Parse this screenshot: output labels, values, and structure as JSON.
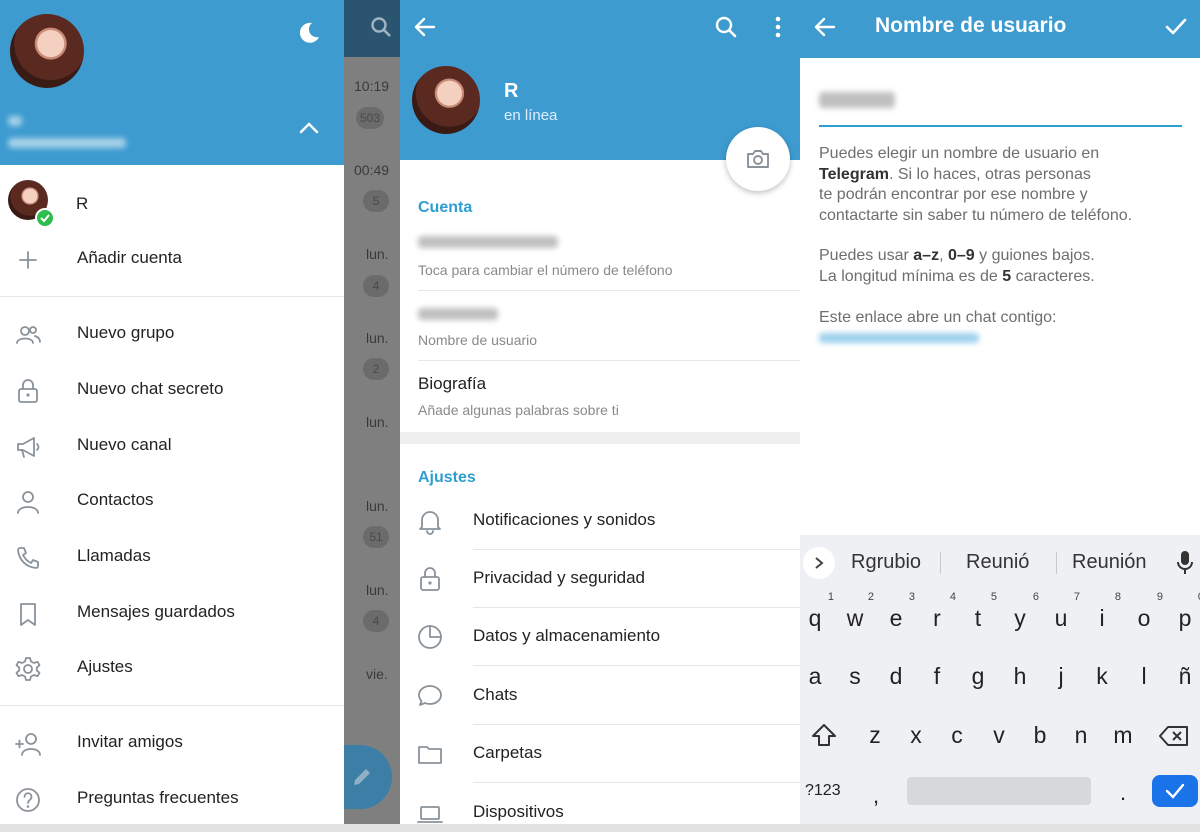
{
  "drawer": {
    "account_name": "R",
    "add_account_label": "Añadir cuenta",
    "items": [
      {
        "label": "Nuevo grupo",
        "icon": "people-icon"
      },
      {
        "label": "Nuevo chat secreto",
        "icon": "lock-icon"
      },
      {
        "label": "Nuevo canal",
        "icon": "megaphone-icon"
      },
      {
        "label": "Contactos",
        "icon": "person-icon"
      },
      {
        "label": "Llamadas",
        "icon": "phone-icon"
      },
      {
        "label": "Mensajes guardados",
        "icon": "bookmark-icon"
      },
      {
        "label": "Ajustes",
        "icon": "gear-icon"
      }
    ],
    "extra_items": [
      {
        "label": "Invitar amigos",
        "icon": "add-person-icon"
      },
      {
        "label": "Preguntas frecuentes",
        "icon": "question-icon"
      }
    ]
  },
  "chat_list": {
    "times": [
      "10:19",
      "00:49",
      "lun.",
      "lun.",
      "lun.",
      "lun.",
      "lun.",
      "vie."
    ],
    "badges": [
      "503",
      "5",
      "4",
      "2",
      "51",
      "4"
    ]
  },
  "profile": {
    "name": "R",
    "status": "en línea",
    "account_section": "Cuenta",
    "phone_hint": "Toca para cambiar el número de teléfono",
    "username_hint": "Nombre de usuario",
    "bio_label": "Biografía",
    "bio_hint": "Añade algunas palabras sobre ti",
    "settings_section": "Ajustes",
    "settings": [
      {
        "label": "Notificaciones y sonidos",
        "icon": "bell-icon"
      },
      {
        "label": "Privacidad y seguridad",
        "icon": "lock-icon"
      },
      {
        "label": "Datos y almacenamiento",
        "icon": "clock-icon"
      },
      {
        "label": "Chats",
        "icon": "chat-bubble-icon"
      },
      {
        "label": "Carpetas",
        "icon": "folder-icon"
      },
      {
        "label": "Dispositivos",
        "icon": "laptop-icon"
      }
    ]
  },
  "username": {
    "title": "Nombre de usuario",
    "p1_a": "Puedes elegir un nombre de usuario en",
    "p1_b": "Telegram",
    "p1_c": ". Si lo haces, otras personas",
    "p1_d": "te podrán encontrar por ese nombre y",
    "p1_e": "contactarte sin saber tu número de teléfono.",
    "p2_a": "Puedes usar ",
    "p2_b": "a–z",
    "p2_c": ", ",
    "p2_d": "0–9",
    "p2_e": " y guiones bajos.",
    "p3_a": "La longitud mínima es de ",
    "p3_b": "5",
    "p3_c": " caracteres.",
    "p4": "Este enlace abre un chat contigo:"
  },
  "keyboard": {
    "suggestions": [
      "Rgrubio",
      "Reunió",
      "Reunión"
    ],
    "row1": [
      "q",
      "w",
      "e",
      "r",
      "t",
      "y",
      "u",
      "i",
      "o",
      "p"
    ],
    "row1_hints": [
      "1",
      "2",
      "3",
      "4",
      "5",
      "6",
      "7",
      "8",
      "9",
      "0"
    ],
    "row2": [
      "a",
      "s",
      "d",
      "f",
      "g",
      "h",
      "j",
      "k",
      "l",
      "ñ"
    ],
    "row3": [
      "z",
      "x",
      "c",
      "v",
      "b",
      "n",
      "m"
    ],
    "symbols_label": "?123",
    "comma": ",",
    "period": "."
  },
  "colors": {
    "header_blue": "#3d9bd0",
    "accent_blue": "#2f9fd1",
    "online_green": "#2dbe4d"
  }
}
